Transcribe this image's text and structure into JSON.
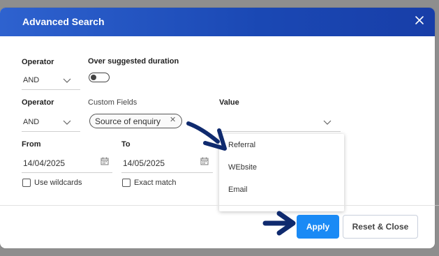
{
  "modal": {
    "title": "Advanced Search",
    "close_icon": "close-icon"
  },
  "row1": {
    "operator_label": "Operator",
    "operator_value": "AND",
    "over_duration_label": "Over suggested duration",
    "over_duration_on": false
  },
  "row2": {
    "operator_label": "Operator",
    "operator_value": "AND",
    "custom_fields_label": "Custom Fields",
    "custom_field_chip": "Source of enquiry",
    "value_label": "Value",
    "value_current": ""
  },
  "row3": {
    "from_label": "From",
    "from_value": "14/04/2025",
    "to_label": "To",
    "to_value": "14/05/2025",
    "use_wildcards_label": "Use wildcards",
    "use_wildcards_checked": false,
    "exact_match_label": "Exact match",
    "exact_match_checked": false
  },
  "value_dropdown": {
    "options": [
      "Referral",
      "WEbsite",
      "Email"
    ]
  },
  "footer": {
    "apply_label": "Apply",
    "reset_close_label": "Reset & Close"
  },
  "colors": {
    "header_start": "#2e62cf",
    "header_end": "#183ea8",
    "apply_bg": "#1a8af5",
    "annotation_arrow": "#0f2a6e"
  }
}
